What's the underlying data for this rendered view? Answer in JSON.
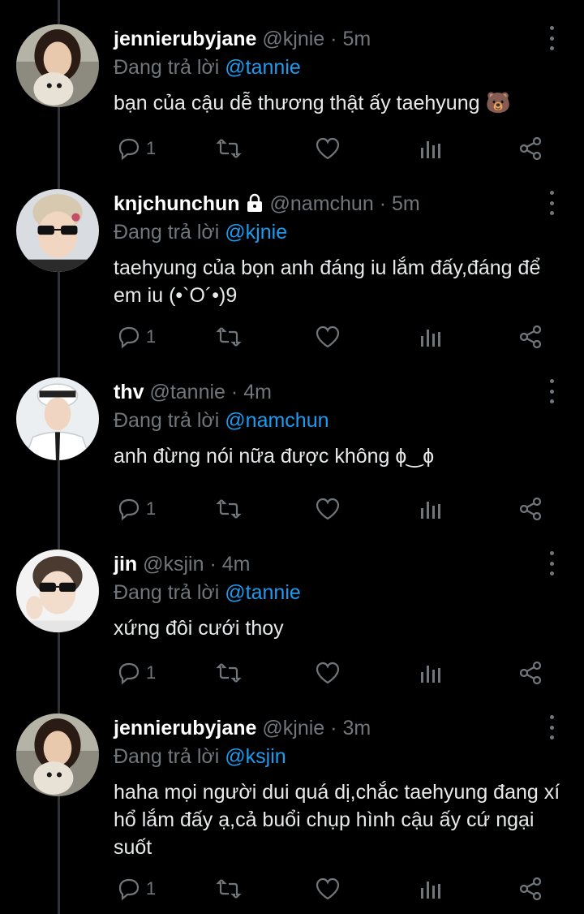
{
  "reply_prefix": "Đang trả lời",
  "tweets": [
    {
      "name": "jennierubyjane",
      "handle": "@kjnie",
      "time": "5m",
      "reply_to": "@tannie",
      "text": "bạn của cậu dễ thương thật ấy taehyung 🐻",
      "reply_count": "1",
      "avatar": "avatar-jennie",
      "has_lock": false
    },
    {
      "name": "knjchunchun",
      "handle": "@namchun",
      "time": "5m",
      "reply_to": "@kjnie",
      "text": "taehyung của bọn anh đáng iu lắm đấy,đáng để em iu (•`O´•)9",
      "reply_count": "1",
      "avatar": "avatar-namchun",
      "has_lock": true
    },
    {
      "name": "thv",
      "handle": "@tannie",
      "time": "4m",
      "reply_to": "@namchun",
      "text": "anh đừng nói nữa được không ɸ‿ɸ",
      "reply_count": "1",
      "avatar": "avatar-thv",
      "has_lock": false
    },
    {
      "name": "jin",
      "handle": "@ksjin",
      "time": "4m",
      "reply_to": "@tannie",
      "text": "xứng đôi cưới thoy",
      "reply_count": "1",
      "avatar": "avatar-jin",
      "has_lock": false
    },
    {
      "name": "jennierubyjane",
      "handle": "@kjnie",
      "time": "3m",
      "reply_to": "@ksjin",
      "text": "haha mọi người dui quá dị,chắc taehyung đang xí hổ lắm đấy ạ,cả buổi chụp hình cậu ấy cứ ngại suốt",
      "reply_count": "1",
      "avatar": "avatar-jennie",
      "has_lock": false
    }
  ],
  "colors": {
    "background": "#000000",
    "text": "#e7e9ea",
    "muted": "#71767b",
    "accent": "#1d9bf0"
  },
  "icons": [
    "reply-icon",
    "retweet-icon",
    "like-icon",
    "views-icon",
    "share-icon",
    "more-icon",
    "lock-icon"
  ]
}
